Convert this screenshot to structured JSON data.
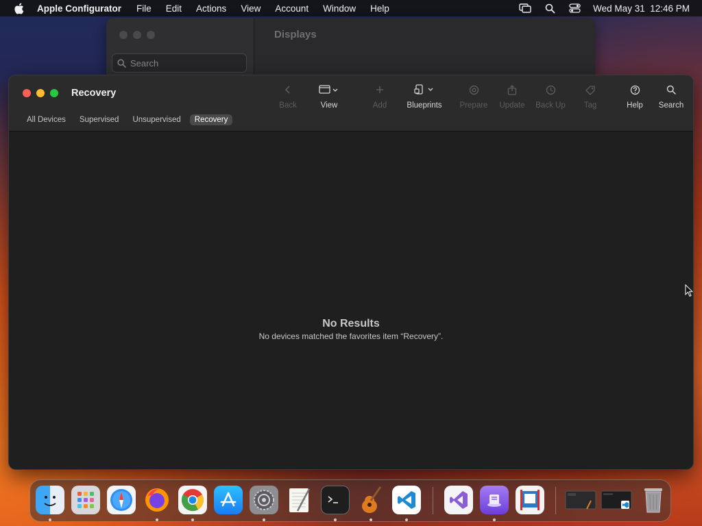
{
  "menubar": {
    "app_name": "Apple Configurator",
    "menus": [
      "File",
      "Edit",
      "Actions",
      "View",
      "Account",
      "Window",
      "Help"
    ],
    "datetime": "Wed May 31  12:46 PM"
  },
  "background_window": {
    "search_placeholder": "Search",
    "title": "Displays"
  },
  "window": {
    "title": "Recovery",
    "toolbar": {
      "back": "Back",
      "view": "View",
      "add": "Add",
      "blueprints": "Blueprints",
      "prepare": "Prepare",
      "update": "Update",
      "backup": "Back Up",
      "tag": "Tag",
      "help": "Help",
      "search": "Search"
    },
    "tabs": [
      "All Devices",
      "Supervised",
      "Unsupervised",
      "Recovery"
    ],
    "active_tab": "Recovery",
    "empty_state": {
      "title": "No Results",
      "message": "No devices matched the favorites item “Recovery”."
    }
  },
  "dock": {
    "apps": [
      "finder-icon",
      "launchpad-icon",
      "safari-icon",
      "firefox-icon",
      "chrome-icon",
      "app-store-icon",
      "system-settings-icon",
      "textedit-icon",
      "terminal-icon",
      "garageband-icon",
      "vscode-icon",
      "visual-studio-icon",
      "apple-configurator-icon",
      "parallels-icon",
      "minimized-window-1",
      "minimized-window-2",
      "trash-icon"
    ]
  }
}
